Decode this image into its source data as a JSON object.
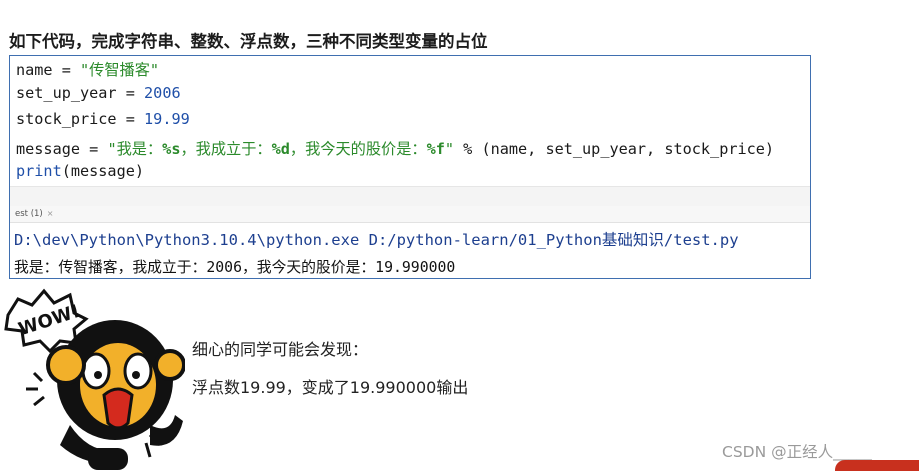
{
  "heading": "如下代码，完成字符串、整数、浮点数，三种不同类型变量的占位",
  "code": {
    "line1": {
      "var": "name",
      "op": " = ",
      "value": "\"传智播客\""
    },
    "line2": {
      "var": "set_up_year",
      "op": " = ",
      "value": "2006"
    },
    "line3": {
      "var": "stock_price",
      "op": " = ",
      "value": "19.99"
    },
    "line4": {
      "var": "message",
      "op": " = ",
      "q1": "\"我是：",
      "fmt_s": "%s",
      "mid1": "，我成立于：",
      "fmt_d": "%d",
      "mid2": "，我今天的股价是：",
      "fmt_f": "%f",
      "q2": "\"",
      "tail": " % (name, set_up_year, stock_price)"
    },
    "line5": {
      "func": "print",
      "args": "(message)"
    }
  },
  "run_tab": {
    "label": "est (1)",
    "close": "×"
  },
  "console": {
    "command": "D:\\dev\\Python\\Python3.10.4\\python.exe D:/python-learn/01_Python基础知识/test.py",
    "output": "我是：传智播客，我成立于：2006，我今天的股价是：19.990000"
  },
  "note": {
    "line1": "细心的同学可能会发现：",
    "line2": "浮点数19.99，变成了19.990000输出"
  },
  "mascot": {
    "bubble_text": "WOW!",
    "icon": "surprised-mascot-icon"
  },
  "watermark": "CSDN @正经人_____",
  "colors": {
    "string": "#2b8a2b",
    "number": "#1f4fa8",
    "border": "#3f6fb0",
    "console_command": "#1d3f8f"
  }
}
